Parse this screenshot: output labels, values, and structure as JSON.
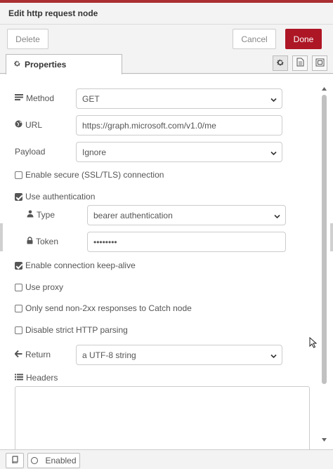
{
  "dialog": {
    "title": "Edit http request node"
  },
  "toolbar": {
    "delete_label": "Delete",
    "cancel_label": "Cancel",
    "done_label": "Done",
    "done_color": "#ad1625"
  },
  "tabs": {
    "properties_label": "Properties"
  },
  "form": {
    "method": {
      "label": "Method",
      "value": "GET"
    },
    "url": {
      "label": "URL",
      "value": "https://graph.microsoft.com/v1.0/me"
    },
    "payload": {
      "label": "Payload",
      "value": "Ignore"
    },
    "ssl": {
      "label": "Enable secure (SSL/TLS) connection",
      "checked": false
    },
    "auth": {
      "label": "Use authentication",
      "checked": true
    },
    "type": {
      "label": "Type",
      "value": "bearer authentication"
    },
    "token": {
      "label": "Token",
      "value": "••••••••"
    },
    "keepalive": {
      "label": "Enable connection keep-alive",
      "checked": true
    },
    "proxy": {
      "label": "Use proxy",
      "checked": false
    },
    "non2xx": {
      "label": "Only send non-2xx responses to Catch node",
      "checked": false
    },
    "strict": {
      "label": "Disable strict HTTP parsing",
      "checked": false
    },
    "return": {
      "label": "Return",
      "value": "a UTF-8 string"
    },
    "headers": {
      "label": "Headers"
    }
  },
  "footer": {
    "enabled_label": "Enabled"
  }
}
